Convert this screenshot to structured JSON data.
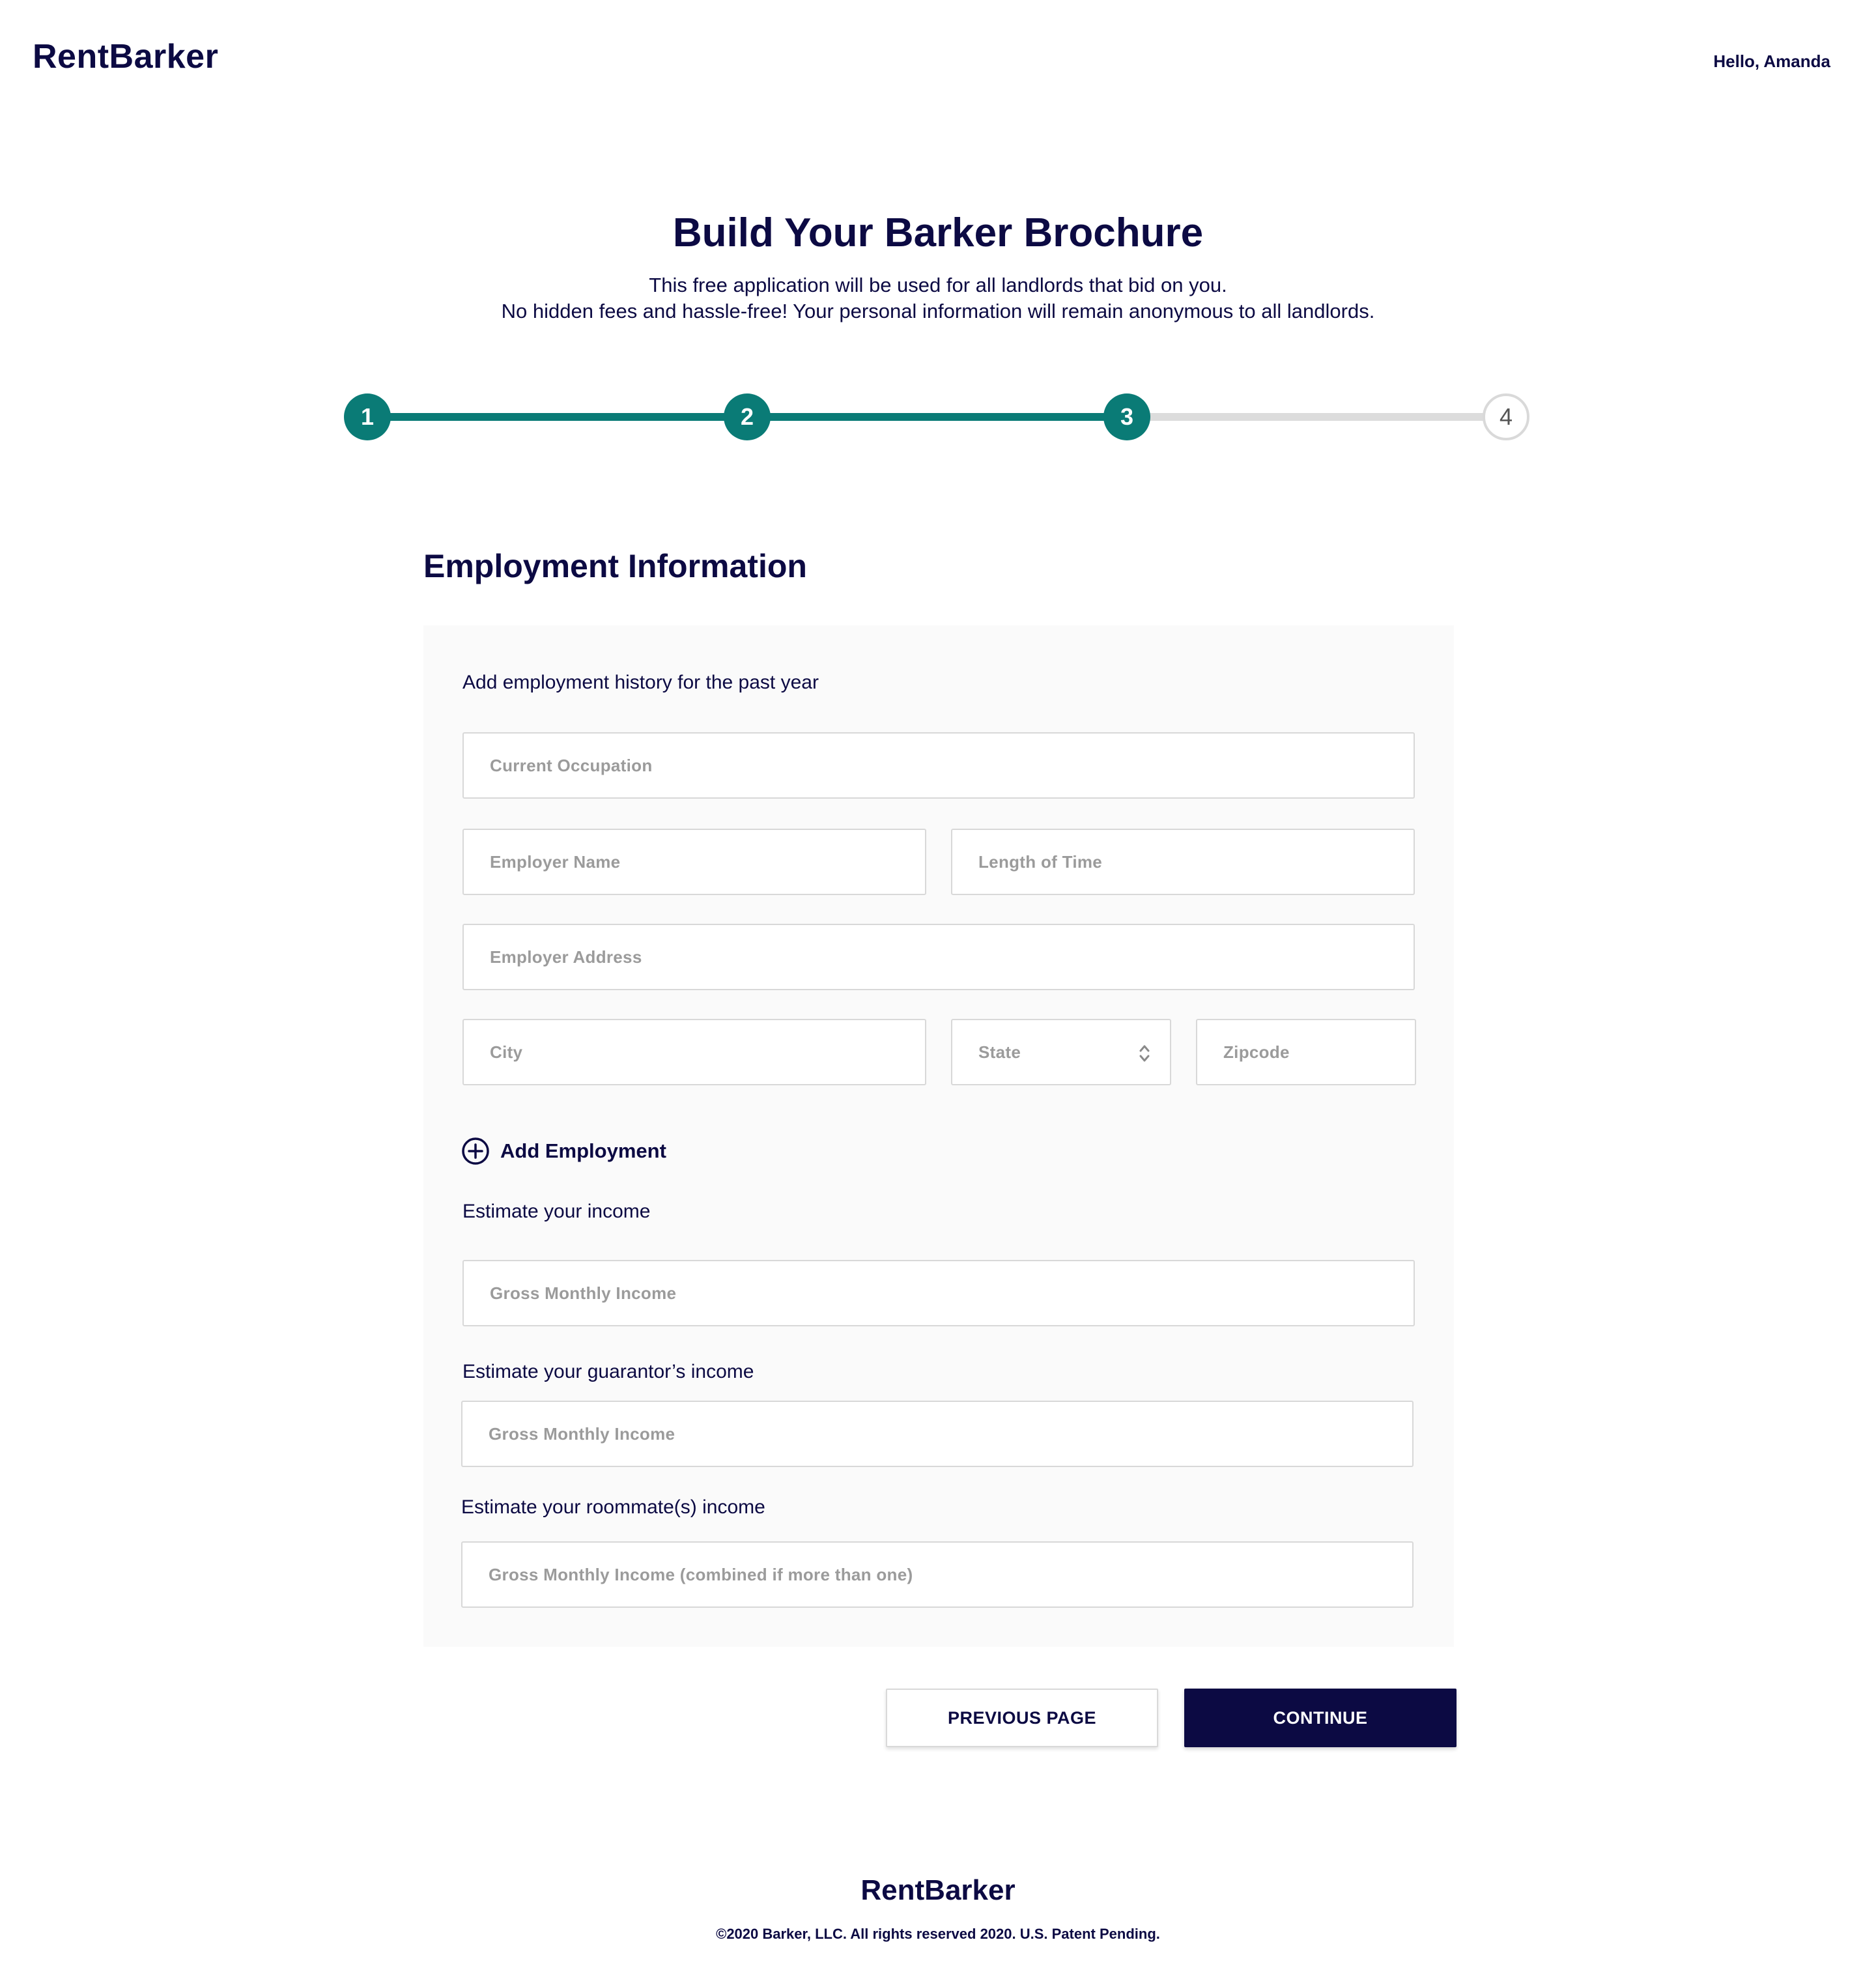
{
  "header": {
    "logo": "RentBarker",
    "greeting": "Hello, Amanda"
  },
  "hero": {
    "title": "Build Your Barker Brochure",
    "subtitle_line1": "This free application will be used for all landlords that bid on you.",
    "subtitle_line2": "No hidden fees and hassle-free! Your personal information will remain anonymous to all landlords."
  },
  "stepper": {
    "steps": [
      "1",
      "2",
      "3",
      "4"
    ],
    "current_step": 3,
    "colors": {
      "done": "#0a7b76",
      "todo": "#dcdcdc"
    }
  },
  "section": {
    "title": "Employment Information"
  },
  "employment": {
    "intro": "Add employment history for the past year",
    "fields": {
      "occupation_placeholder": "Current Occupation",
      "employer_name_placeholder": "Employer Name",
      "length_of_time_placeholder": "Length of Time",
      "employer_address_placeholder": "Employer Address",
      "city_placeholder": "City",
      "state_placeholder": "State",
      "zipcode_placeholder": "Zipcode"
    },
    "add_employment_label": "Add Employment"
  },
  "income": {
    "own_label": "Estimate your income",
    "own_placeholder": "Gross Monthly Income",
    "guarantor_label": "Estimate your guarantor’s income",
    "guarantor_placeholder": "Gross Monthly Income",
    "roommate_label": "Estimate your roommate(s) income",
    "roommate_placeholder": "Gross Monthly Income (combined if more than one)"
  },
  "actions": {
    "previous_label": "PREVIOUS PAGE",
    "continue_label": "CONTINUE"
  },
  "footer": {
    "logo": "RentBarker",
    "copyright": "©2020 Barker, LLC. All rights reserved 2020. U.S. Patent Pending."
  },
  "theme": {
    "navy": "#0c0a43",
    "teal": "#0a7b76",
    "card_bg": "#fafafa"
  }
}
